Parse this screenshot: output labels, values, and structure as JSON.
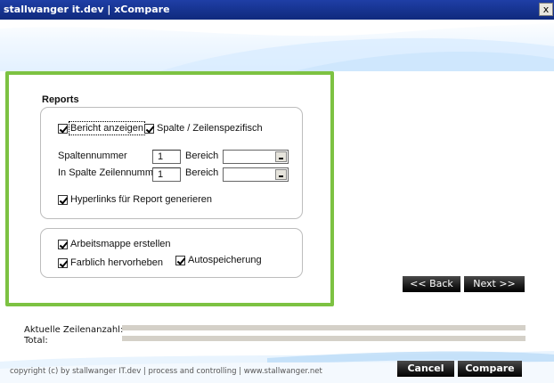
{
  "window": {
    "title": "stallwanger it.dev | xCompare",
    "close_label": "x"
  },
  "reports": {
    "title": "Reports",
    "bericht_anzeigen": "Bericht anzeigen",
    "spalte_zeilenspezifisch": "Spalte / Zeilenspezifisch",
    "spaltennummer_label": "Spaltennummer",
    "spaltennummer_value": "1",
    "bereich_label_1": "Bereich",
    "in_spalte_label": "In Spalte Zeilennummer",
    "in_spalte_value": "1",
    "bereich_label_2": "Bereich",
    "hyperlinks": "Hyperlinks für Report generieren",
    "arbeitsmappe": "Arbeitsmappe erstellen",
    "farblich": "Farblich hervorheben",
    "autospeicherung": "Autospeicherung"
  },
  "nav": {
    "back_label": "<< Back",
    "next_label": "Next >>"
  },
  "progress": {
    "aktuelle_label": "Aktuelle Zeilenanzahl:",
    "total_label": "Total:"
  },
  "footer": {
    "copyright": "copyright (c) by stallwanger IT.dev | process and controlling   | www.stallwanger.net",
    "cancel_label": "Cancel",
    "compare_label": "Compare"
  },
  "colors": {
    "accent_green": "#7dc242",
    "title_blue": "#16338f"
  }
}
